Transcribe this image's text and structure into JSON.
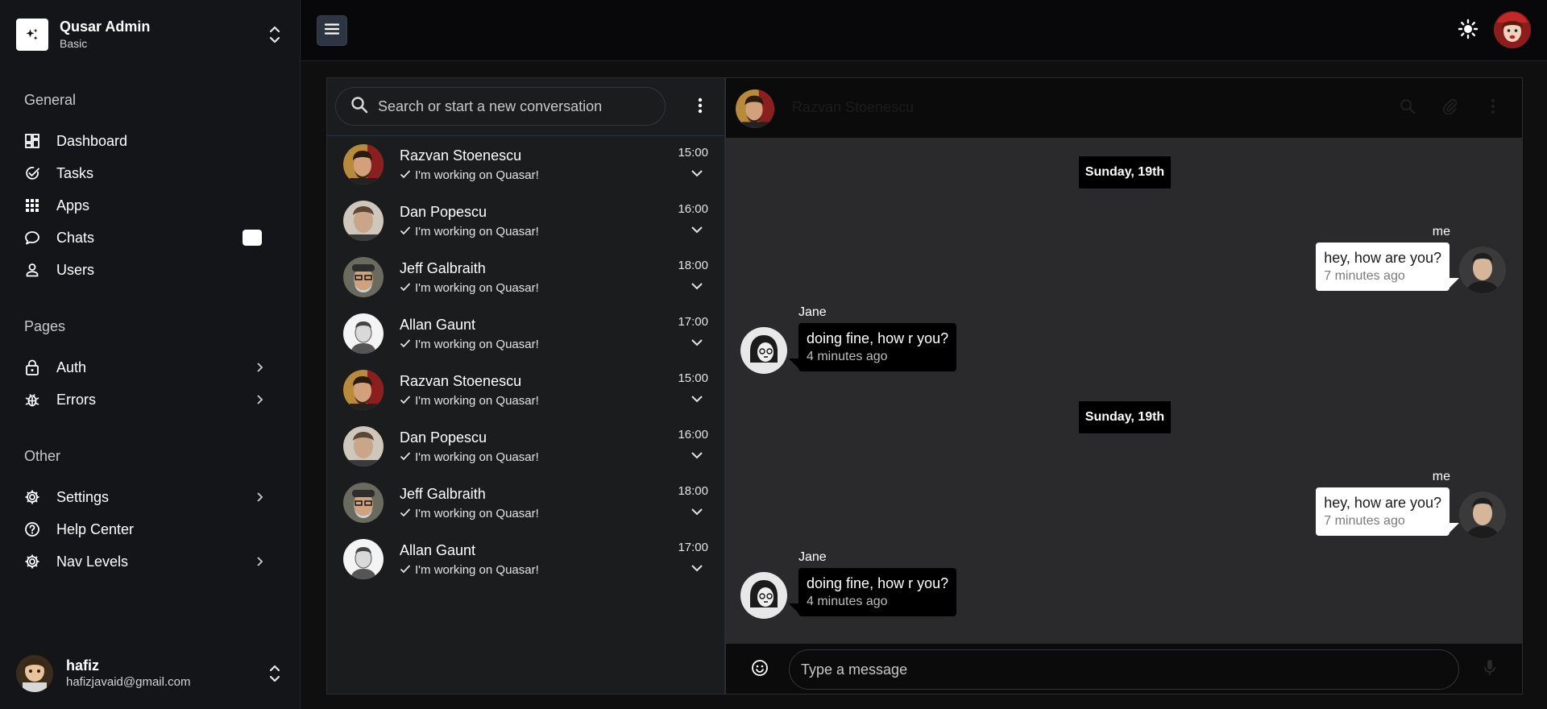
{
  "brand": {
    "title": "Qusar Admin",
    "subtitle": "Basic"
  },
  "sections": {
    "general": "General",
    "pages": "Pages",
    "other": "Other"
  },
  "nav": {
    "dashboard": "Dashboard",
    "tasks": "Tasks",
    "apps": "Apps",
    "chats": "Chats",
    "users": "Users",
    "auth": "Auth",
    "errors": "Errors",
    "settings": "Settings",
    "help": "Help Center",
    "nav_levels": "Nav Levels"
  },
  "user": {
    "name": "hafiz",
    "email": "hafizjavaid@gmail.com"
  },
  "search": {
    "placeholder": "Search or start a new conversation"
  },
  "conversations": [
    {
      "name": "Razvan Stoenescu",
      "message": "I'm working on Quasar!",
      "time": "15:00"
    },
    {
      "name": "Dan Popescu",
      "message": "I'm working on Quasar!",
      "time": "16:00"
    },
    {
      "name": "Jeff Galbraith",
      "message": "I'm working on Quasar!",
      "time": "18:00"
    },
    {
      "name": "Allan Gaunt",
      "message": "I'm working on Quasar!",
      "time": "17:00"
    },
    {
      "name": "Razvan Stoenescu",
      "message": "I'm working on Quasar!",
      "time": "15:00"
    },
    {
      "name": "Dan Popescu",
      "message": "I'm working on Quasar!",
      "time": "16:00"
    },
    {
      "name": "Jeff Galbraith",
      "message": "I'm working on Quasar!",
      "time": "18:00"
    },
    {
      "name": "Allan Gaunt",
      "message": "I'm working on Quasar!",
      "time": "17:00"
    }
  ],
  "chat": {
    "contact_name": "Razvan Stoenescu",
    "date_1": "Sunday, 19th",
    "date_2": "Sunday, 19th",
    "messages": [
      {
        "sender": "me",
        "text": "hey, how are you?",
        "time": "7 minutes ago"
      },
      {
        "sender": "Jane",
        "text": "doing fine, how r you?",
        "time": "4 minutes ago"
      },
      {
        "sender": "me",
        "text": "hey, how are you?",
        "time": "7 minutes ago"
      },
      {
        "sender": "Jane",
        "text": "doing fine, how r you?",
        "time": "4 minutes ago"
      }
    ]
  },
  "compose": {
    "placeholder": "Type a message"
  },
  "colors": {
    "sidebar_bg": "#141518",
    "header_bg": "#08080a",
    "list_bg": "#1b1c1e",
    "chat_bg": "#2a2a2c",
    "accent_menu": "#2d3442"
  }
}
